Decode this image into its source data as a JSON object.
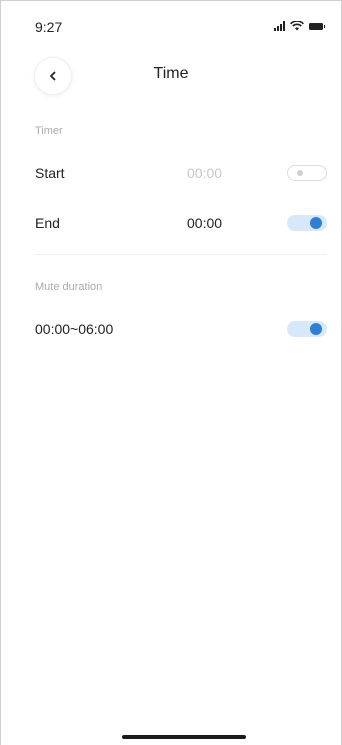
{
  "status_bar": {
    "time": "9:27",
    "icons": [
      "signal-icon",
      "wifi-icon",
      "battery-icon"
    ]
  },
  "header": {
    "back_icon": "chevron-left-icon",
    "title": "Time"
  },
  "timer": {
    "section_label": "Timer",
    "start": {
      "label": "Start",
      "time": "00:00",
      "enabled": false
    },
    "end": {
      "label": "End",
      "time": "00:00",
      "enabled": true
    }
  },
  "mute": {
    "section_label": "Mute duration",
    "range": "00:00~06:00",
    "enabled": true
  },
  "colors": {
    "accent": "#2f7fd3",
    "toggle_track_on": "#d6e8f9",
    "muted_text": "#aaaaaa",
    "disabled_text": "#c8c8c8"
  }
}
